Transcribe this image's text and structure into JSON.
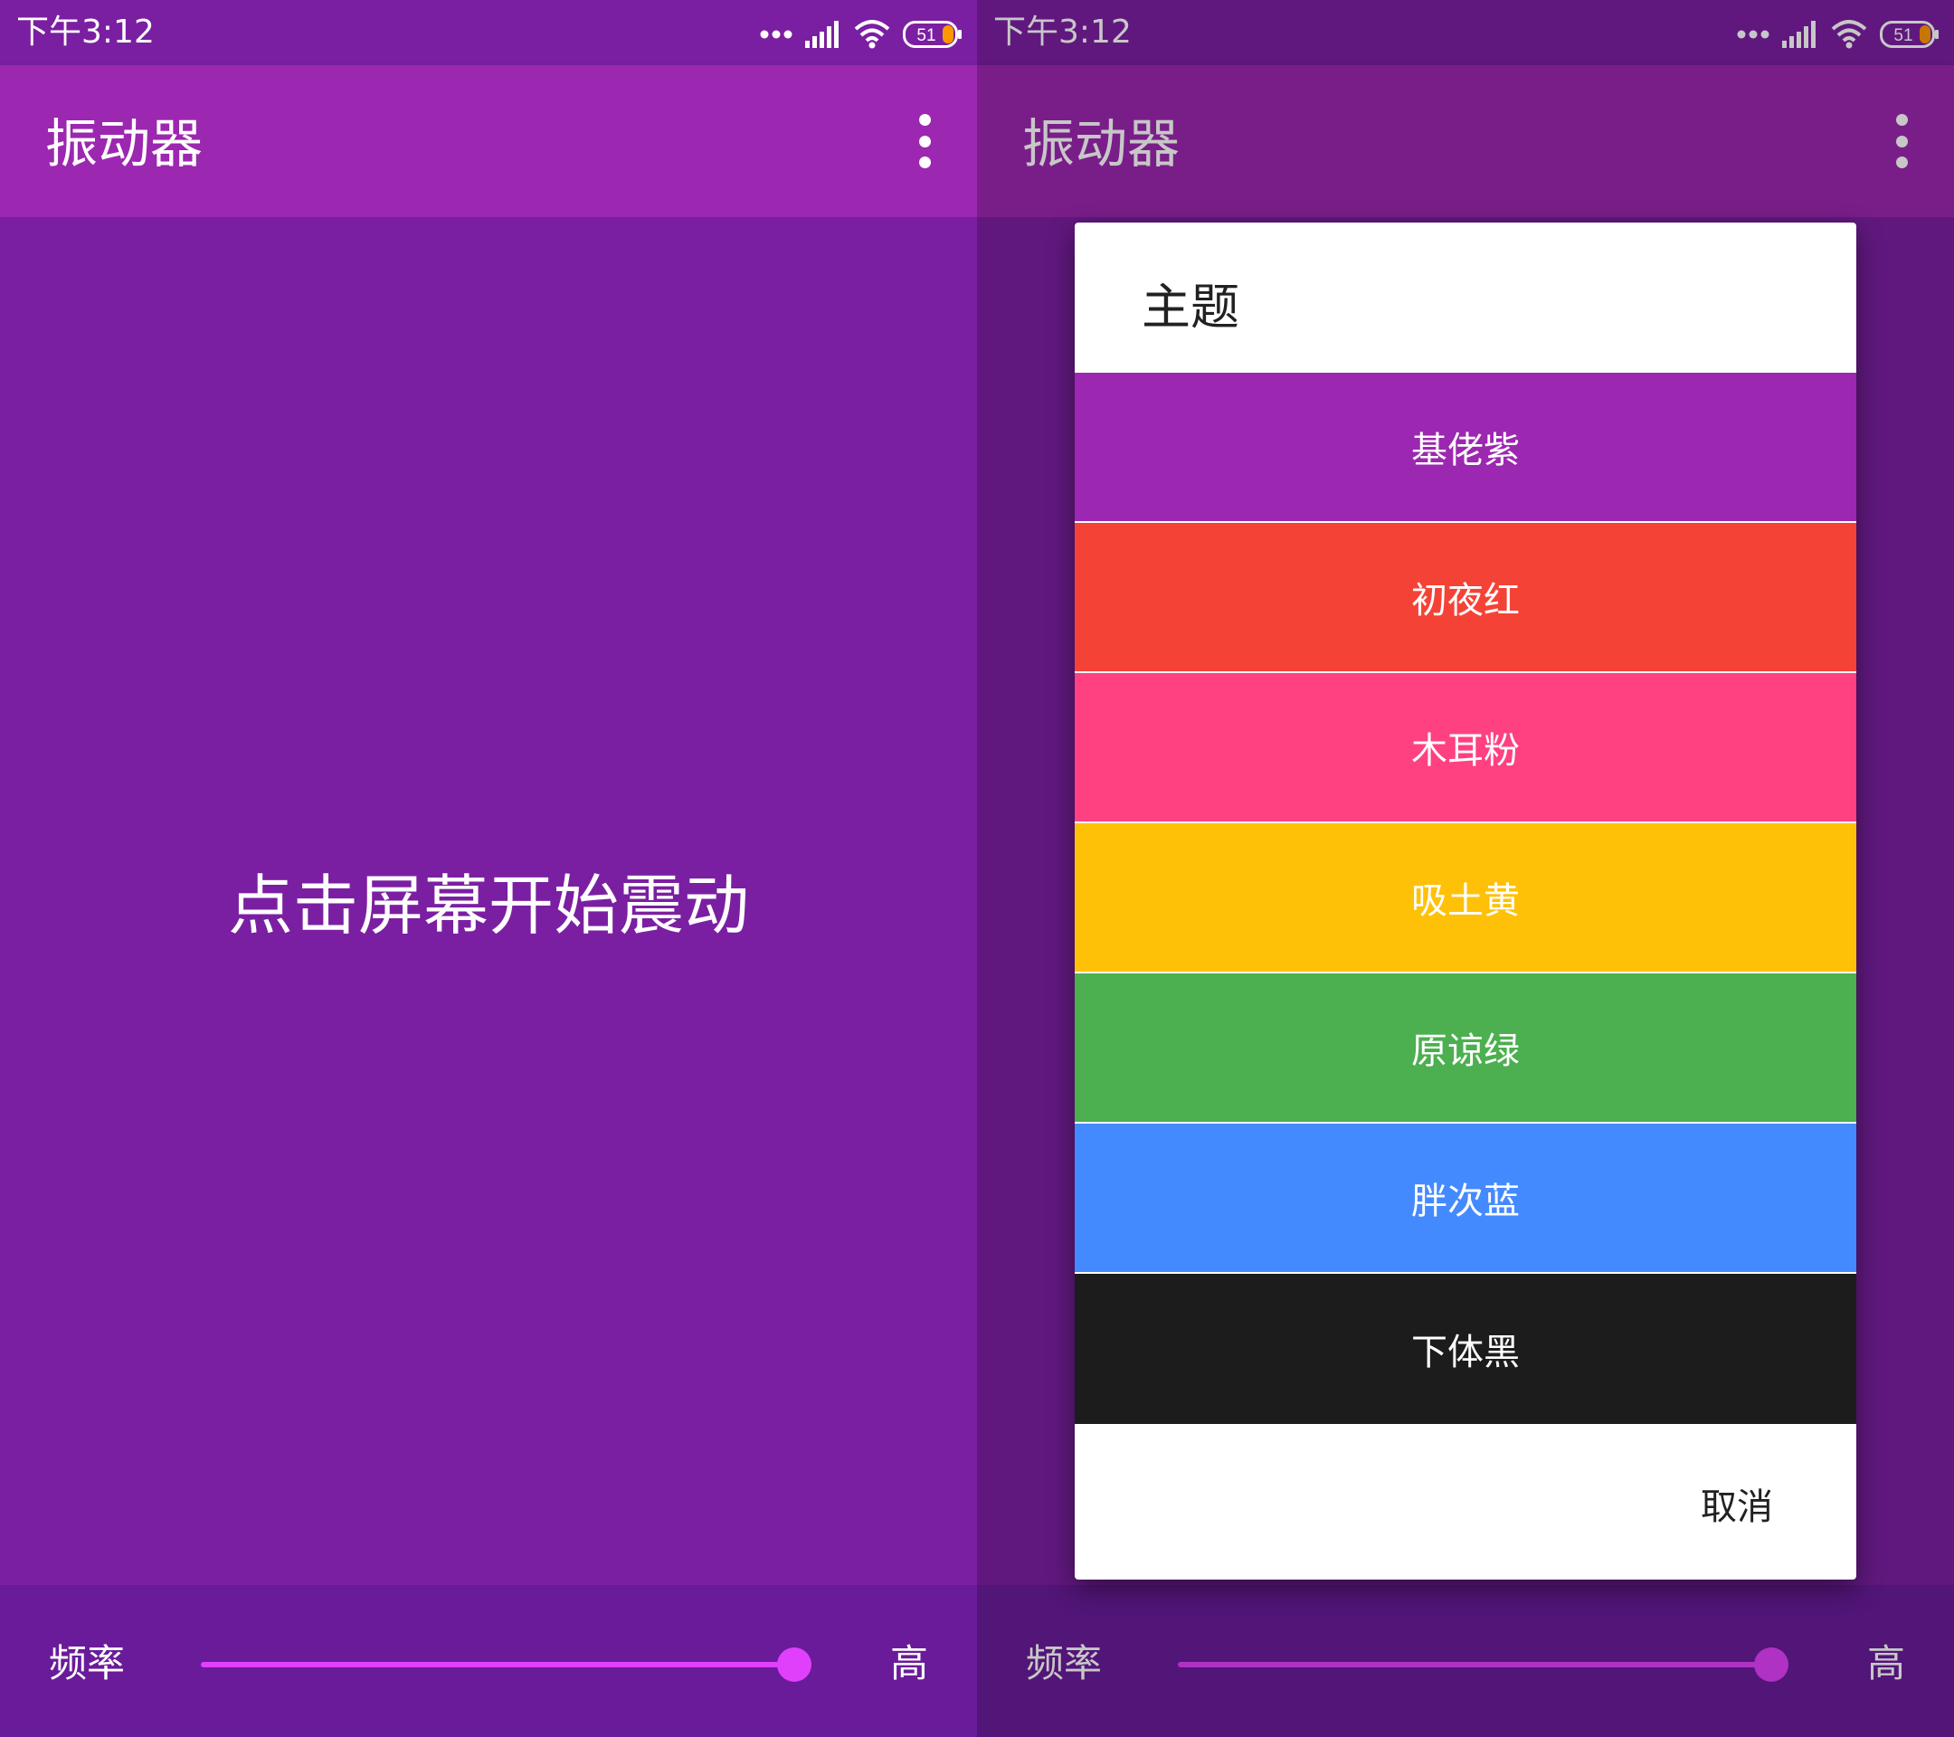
{
  "status_bar": {
    "time": "下午3:12",
    "battery": "51",
    "icons": [
      "more-dots-icon",
      "signal-icon",
      "wifi-icon",
      "battery-icon"
    ]
  },
  "app_bar": {
    "title": "振动器",
    "menu_icon": "overflow-menu-icon"
  },
  "main": {
    "hint": "点击屏幕开始震动"
  },
  "bottom_bar": {
    "frequency_label": "频率",
    "high_label": "高",
    "slider_value_fraction": 0.97
  },
  "theme_dialog": {
    "title": "主题",
    "options": [
      {
        "label": "基佬紫",
        "color": "#9C27B0"
      },
      {
        "label": "初夜红",
        "color": "#F44336"
      },
      {
        "label": "木耳粉",
        "color": "#FF4081"
      },
      {
        "label": "吸土黄",
        "color": "#FFC107"
      },
      {
        "label": "原谅绿",
        "color": "#4CAF50"
      },
      {
        "label": "胖次蓝",
        "color": "#448AFF"
      },
      {
        "label": "下体黑",
        "color": "#1C1C1C"
      }
    ],
    "cancel_label": "取消"
  },
  "colors": {
    "primary": "#9C27B0",
    "primary_dark": "#7B1FA2",
    "bottom_bar": "#6A1B9A",
    "accent": "#E040FB"
  }
}
